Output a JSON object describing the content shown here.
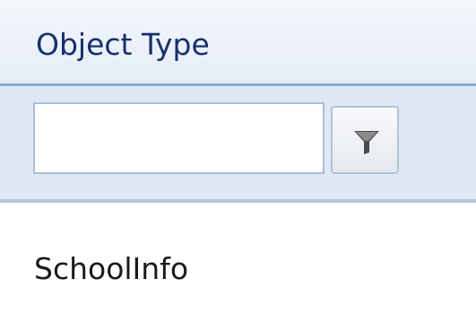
{
  "grid": {
    "column_header": "Object Type",
    "filter": {
      "value": "",
      "placeholder": "",
      "button_icon": "funnel-filter-icon"
    },
    "rows": [
      {
        "object_type": "SchoolInfo"
      }
    ]
  }
}
